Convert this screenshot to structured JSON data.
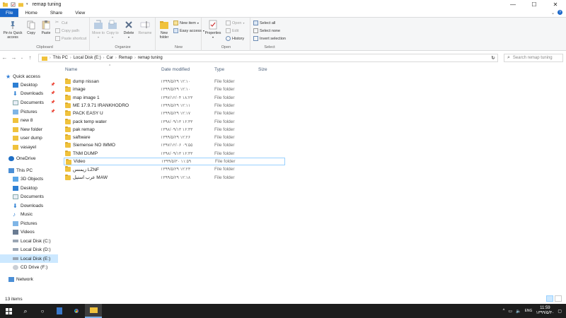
{
  "window": {
    "title": "remap tuning",
    "controls": {
      "minimize": "—",
      "maximize": "☐",
      "close": "✕"
    }
  },
  "ribbon_tabs": [
    "File",
    "Home",
    "Share",
    "View"
  ],
  "ribbon": {
    "clipboard": {
      "label": "Clipboard",
      "pin": "Pin to Quick access",
      "copy": "Copy",
      "paste": "Paste",
      "cut": "Cut",
      "copy_path": "Copy path",
      "paste_shortcut": "Paste shortcut"
    },
    "organize": {
      "label": "Organize",
      "move_to": "Move to",
      "copy_to": "Copy to",
      "delete": "Delete",
      "rename": "Rename"
    },
    "new": {
      "label": "New",
      "new_folder": "New folder",
      "new_item": "New item",
      "easy_access": "Easy access"
    },
    "open": {
      "label": "Open",
      "properties": "Properties",
      "open": "Open",
      "edit": "Edit",
      "history": "History"
    },
    "select": {
      "label": "Select",
      "select_all": "Select all",
      "select_none": "Select none",
      "invert": "Invert selection"
    }
  },
  "address": {
    "crumbs": [
      "This PC",
      "Local Disk (E:)",
      "Car",
      "Remap",
      "remap tuning"
    ],
    "search_placeholder": "Search remap tuning"
  },
  "nav": {
    "quick_access": "Quick access",
    "quick_items": [
      "Desktop",
      "Downloads",
      "Documents",
      "Pictures",
      "new 8",
      "New folder",
      "user dump",
      "vasayel"
    ],
    "onedrive": "OneDrive",
    "this_pc": "This PC",
    "pc_items": [
      "3D Objects",
      "Desktop",
      "Documents",
      "Downloads",
      "Music",
      "Pictures",
      "Videos",
      "Local Disk (C:)",
      "Local Disk (D:)",
      "Local Disk (E:)",
      "CD Drive (F:)"
    ],
    "network": "Network"
  },
  "columns": {
    "name": "Name",
    "date": "Date modified",
    "type": "Type",
    "size": "Size"
  },
  "files": [
    {
      "name": "dump nissan",
      "date": "۱۳۹۹/۵/۲۹ ۱۲:۱۰",
      "type": "File folder"
    },
    {
      "name": "image",
      "date": "۱۳۹۹/۵/۲۹ ۱۲:۱۰",
      "type": "File folder"
    },
    {
      "name": "map image 1",
      "date": "۱۳۹۷/۱۲/۰۴ ۱۸:۲۳",
      "type": "File folder"
    },
    {
      "name": "ME 17.9.71 IRANKHODRO",
      "date": "۱۳۹۹/۵/۲۹ ۱۲:۱۱",
      "type": "File folder"
    },
    {
      "name": "PACK EASY U",
      "date": "۱۳۹۹/۵/۲۹ ۱۲:۱۷",
      "type": "File folder"
    },
    {
      "name": "pack temp water",
      "date": "۱۳۹۸/۰۹/۱۳ ۱۶:۳۳",
      "type": "File folder"
    },
    {
      "name": "pak remap",
      "date": "۱۳۹۸/۰۹/۱۳ ۱۶:۳۳",
      "type": "File folder"
    },
    {
      "name": "saftware",
      "date": "۱۳۹۹/۵/۲۹ ۱۲:۲۶",
      "type": "File folder"
    },
    {
      "name": "Siemense NO IMMO",
      "date": "۱۳۹۷/۱۲/۰۶ ۰۹:۵۵",
      "type": "File folder"
    },
    {
      "name": "TNM DUMP",
      "date": "۱۳۹۸/۰۹/۱۳ ۱۶:۳۳",
      "type": "File folder"
    },
    {
      "name": "Video",
      "date": "۱۳۹۹/۵/۳۰ ۱۱:۵۹",
      "type": "File folder"
    },
    {
      "name": "زیمنس LZNF",
      "date": "۱۳۹۹/۵/۲۹ ۱۲:۲۳",
      "type": "File folder"
    },
    {
      "name": "عرب استیل MAW",
      "date": "۱۳۹۹/۵/۲۹ ۱۲:۱۸",
      "type": "File folder"
    }
  ],
  "status": {
    "items": "13 items"
  },
  "taskbar": {
    "time": "11:59",
    "date": "۱۳۹۹/۵/۳۰",
    "lang": "ENG"
  },
  "colors": {
    "accent": "#1a67c9",
    "selection": "#cce8ff",
    "folder": "#f0c23c"
  }
}
